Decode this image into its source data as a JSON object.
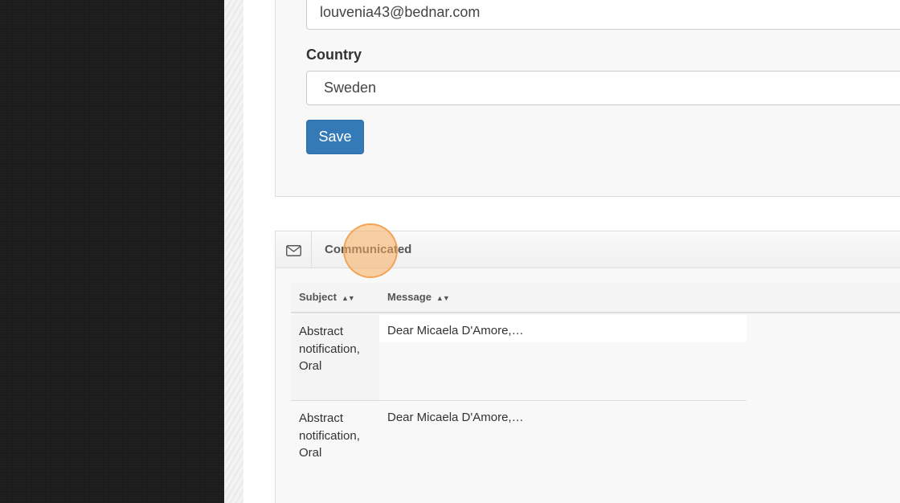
{
  "form": {
    "email_value": "louvenia43@bednar.com",
    "country_label": "Country",
    "country_value": "Sweden",
    "save_label": "Save"
  },
  "communicated": {
    "icon": "envelope-icon",
    "title": "Communicated",
    "columns": [
      "Subject",
      "Message"
    ],
    "sort_glyph": "▲▼",
    "rows": [
      {
        "subject": "Abstract notification, Oral",
        "message": "Dear Micaela D'Amore,…"
      },
      {
        "subject": "Abstract notification, Oral",
        "message": "Dear Micaela D'Amore,…"
      }
    ]
  },
  "colors": {
    "primary_button": "#337ab7",
    "click_highlight": "#f7ab5c"
  }
}
